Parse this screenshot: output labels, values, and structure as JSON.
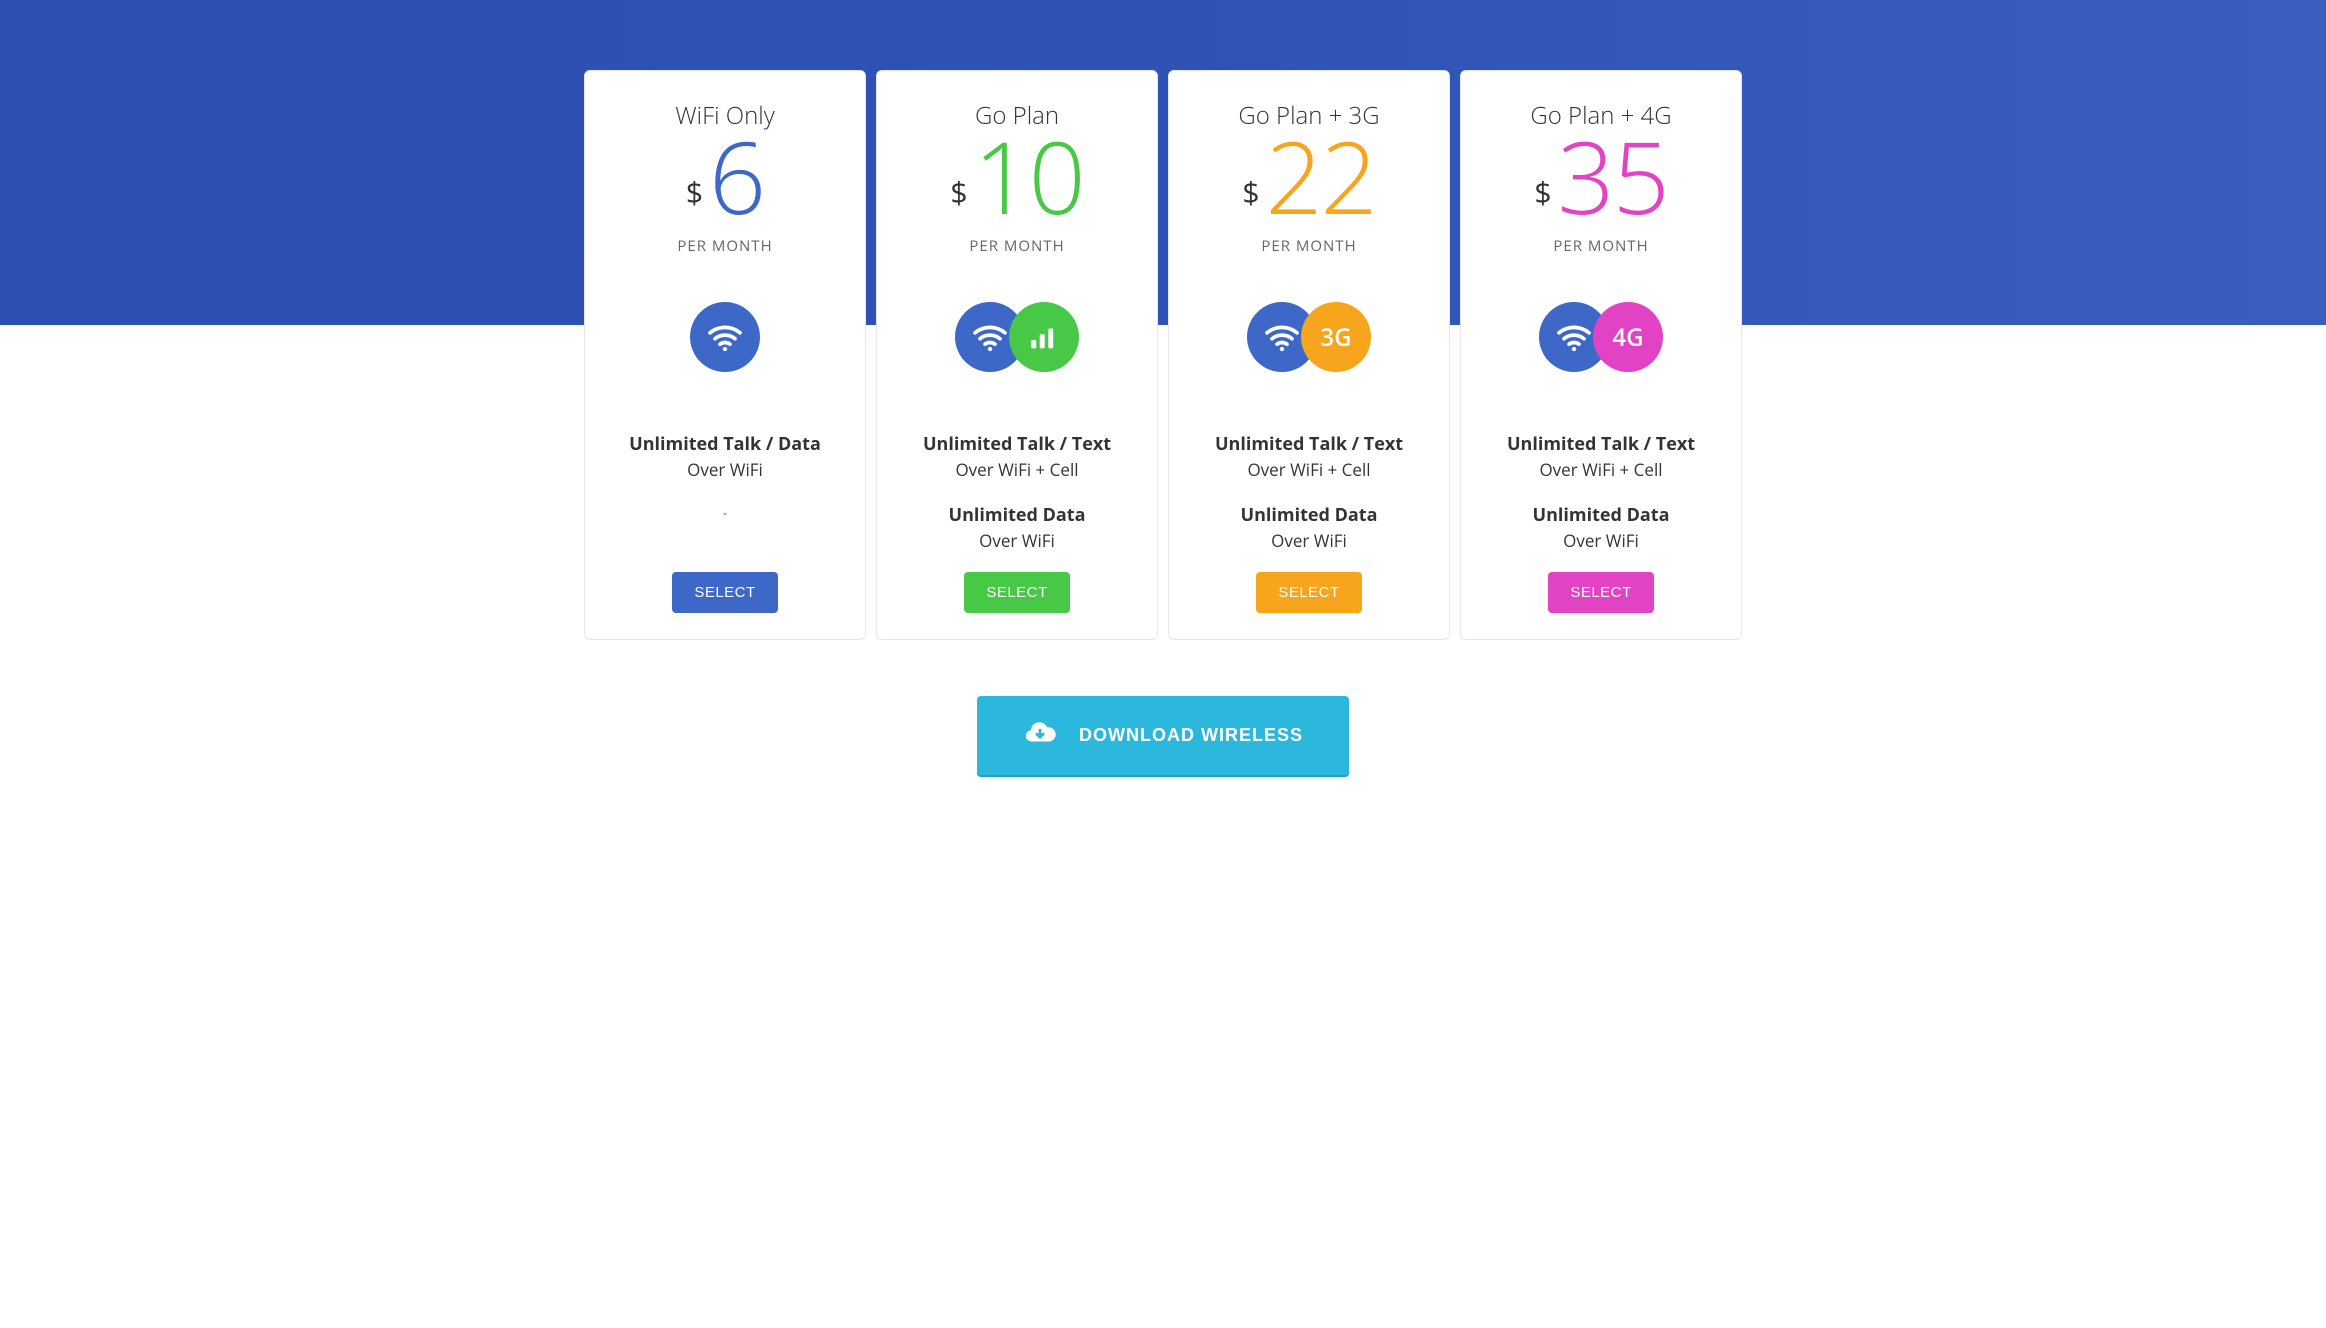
{
  "plans": [
    {
      "name": "WiFi Only",
      "currency": "$",
      "price": "6",
      "period": "PER MONTH",
      "feat1_title": "Unlimited Talk / Data",
      "feat1_sub": "Over WiFi",
      "feat2_title": "",
      "feat2_sub": "-",
      "select": "SELECT"
    },
    {
      "name": "Go Plan",
      "currency": "$",
      "price": "10",
      "period": "PER MONTH",
      "feat1_title": "Unlimited Talk / Text",
      "feat1_sub": "Over WiFi + Cell",
      "feat2_title": "Unlimited Data",
      "feat2_sub": "Over WiFi",
      "select": "SELECT"
    },
    {
      "name": "Go Plan + 3G",
      "currency": "$",
      "price": "22",
      "period": "PER MONTH",
      "feat1_title": "Unlimited Talk / Text",
      "feat1_sub": "Over WiFi + Cell",
      "feat2_title": "Unlimited Data",
      "feat2_sub": "Over WiFi",
      "select": "SELECT",
      "badge": "3G"
    },
    {
      "name": "Go Plan + 4G",
      "currency": "$",
      "price": "35",
      "period": "PER MONTH",
      "feat1_title": "Unlimited Talk / Text",
      "feat1_sub": "Over WiFi + Cell",
      "feat2_title": "Unlimited Data",
      "feat2_sub": "Over WiFi",
      "select": "SELECT",
      "badge": "4G"
    }
  ],
  "cta": {
    "label": "DOWNLOAD WIRELESS"
  }
}
